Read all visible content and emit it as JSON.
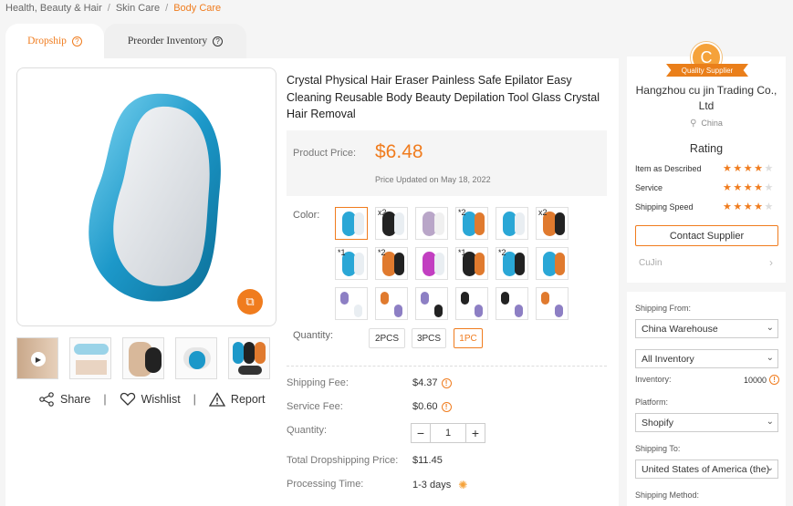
{
  "breadcrumb": [
    "Health, Beauty & Hair",
    "Skin Care",
    "Body Care"
  ],
  "tabs": {
    "dropship": "Dropship",
    "preorder": "Preorder Inventory"
  },
  "product": {
    "title": "Crystal Physical Hair Eraser Painless Safe Epilator Easy Cleaning Reusable Body Beauty Depilation Tool Glass Crystal Hair Removal",
    "price_label": "Product Price:",
    "price": "$6.48",
    "price_updated": "Price Updated on May 18, 2022",
    "color_label": "Color:",
    "quantity_label": "Quantity:",
    "variant_options": [
      "2PCS",
      "3PCS",
      "1PC"
    ],
    "selected_variant": "1PC"
  },
  "swatch_tags": [
    "x2",
    "*2",
    "x2",
    "*1",
    "*2",
    "*1",
    "*2"
  ],
  "actions": {
    "share": "Share",
    "wishlist": "Wishlist",
    "report": "Report"
  },
  "details": {
    "shipping_fee_label": "Shipping Fee:",
    "shipping_fee": "$4.37",
    "service_fee_label": "Service Fee:",
    "service_fee": "$0.60",
    "quantity_label": "Quantity:",
    "quantity": "1",
    "total_label": "Total Dropshipping Price:",
    "total": "$11.45",
    "processing_label": "Processing Time:",
    "processing": "1-3 days"
  },
  "supplier": {
    "logo_letter": "C",
    "badge": "Quality Supplier",
    "name": "Hangzhou cu jin Trading Co., Ltd",
    "country": "China",
    "rating_title": "Rating",
    "ratings": [
      {
        "label": "Item as Described",
        "stars": 4
      },
      {
        "label": "Service",
        "stars": 4
      },
      {
        "label": "Shipping Speed",
        "stars": 4
      }
    ],
    "contact": "Contact Supplier",
    "store": "CuJin"
  },
  "shipping": {
    "from_label": "Shipping From:",
    "from": "China Warehouse",
    "inventory_select": "All Inventory",
    "inventory_label": "Inventory:",
    "inventory": "10000",
    "platform_label": "Platform:",
    "platform": "Shopify",
    "to_label": "Shipping To:",
    "to": "United States of America (the)",
    "method_label": "Shipping Method:"
  },
  "colors": {
    "accent": "#f07c1e",
    "device_blue": "#2aa7d6",
    "border": "#dddddd"
  }
}
